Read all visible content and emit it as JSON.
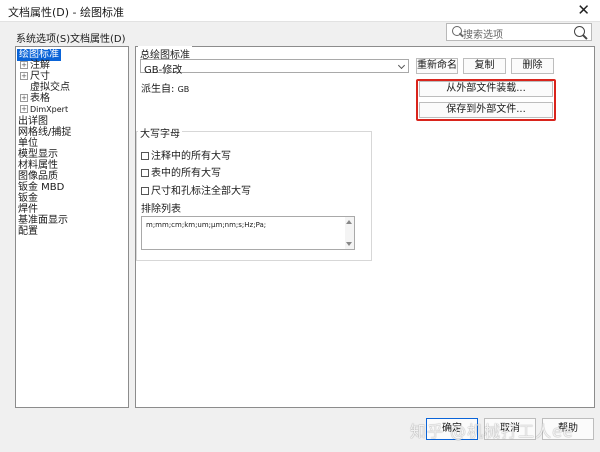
{
  "window": {
    "title": "文档属性(D) - 绘图标准",
    "close_glyph": "✕"
  },
  "tabs": [
    {
      "label": "系统选项(S)"
    },
    {
      "label": "文档属性(D)"
    }
  ],
  "search": {
    "placeholder": "搜索选项"
  },
  "tree": {
    "items": [
      {
        "label": "绘图标准",
        "selected": true
      },
      {
        "label": "注解",
        "expander": "+"
      },
      {
        "label": "尺寸",
        "expander": "+"
      },
      {
        "label": "虚拟交点"
      },
      {
        "label": "表格",
        "expander": "+"
      },
      {
        "label": "DimXpert",
        "expander": "+"
      },
      {
        "label": "出详图"
      },
      {
        "label": "网格线/捕捉"
      },
      {
        "label": "单位"
      },
      {
        "label": "模型显示"
      },
      {
        "label": "材料属性"
      },
      {
        "label": "图像品质"
      },
      {
        "label": "钣金 MBD"
      },
      {
        "label": "钣金"
      },
      {
        "label": "焊件"
      },
      {
        "label": "基准面显示"
      },
      {
        "label": "配置"
      }
    ]
  },
  "standard": {
    "group_label": "总绘图标准",
    "combo_value": "GB-修改",
    "rename_button": "重新命名",
    "copy_button": "复制",
    "delete_button": "删除",
    "derived_label": "派生自:",
    "derived_value": "GB",
    "load_button": "从外部文件装载...",
    "save_button": "保存到外部文件..."
  },
  "caps": {
    "group_label": "大写字母",
    "opt_notes": "注释中的所有大写",
    "opt_tables": "表中的所有大写",
    "opt_dims": "尺寸和孔标注全部大写",
    "exclude_label": "排除列表",
    "exclude_value": "m;mm;cm;km;um;µm;nm;s;Hz;Pa;"
  },
  "footer": {
    "ok_button": "确定",
    "cancel_button": "取消",
    "help_button": "帮助"
  },
  "watermark": "知乎 @机械打工人ee",
  "colors": {
    "accent": "#0a64d8",
    "highlight": "#d9241c"
  }
}
